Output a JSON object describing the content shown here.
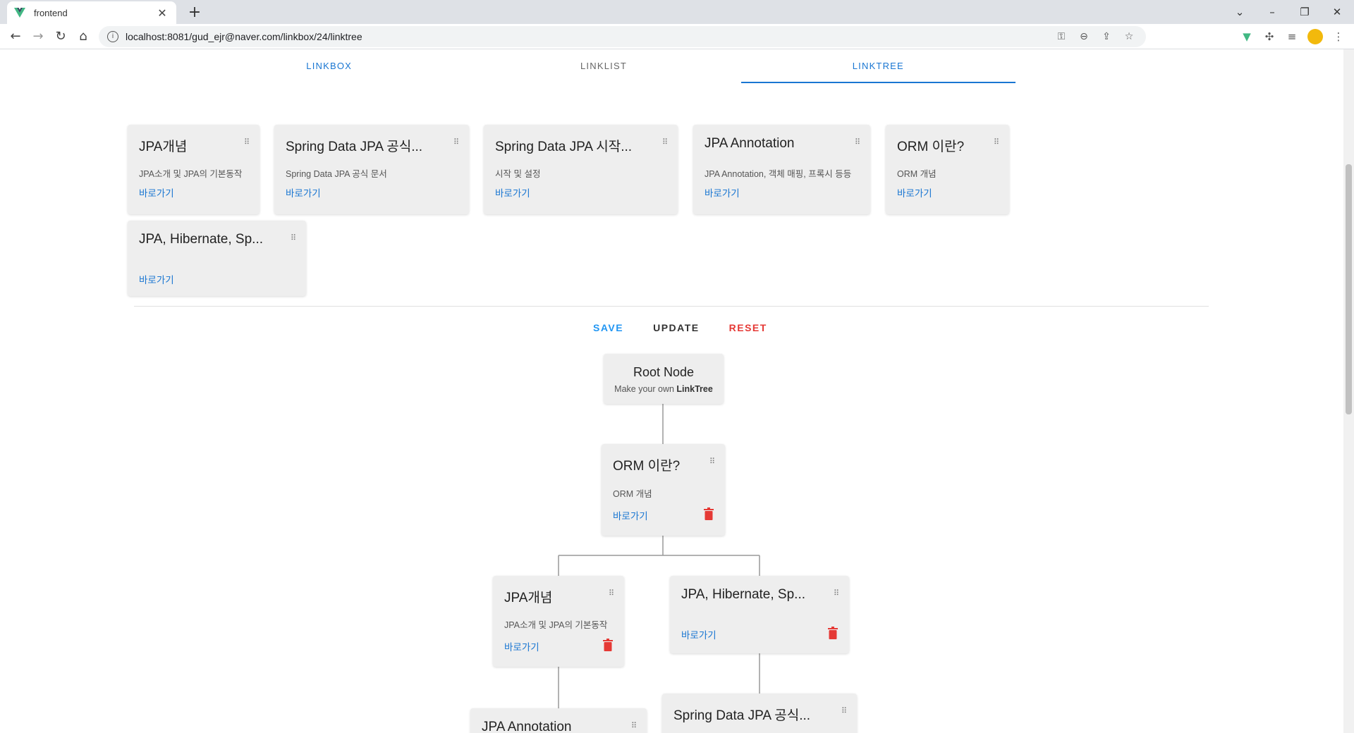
{
  "browser": {
    "tab_title": "frontend",
    "url": "localhost:8081/gud_ejr@naver.com/linkbox/24/linktree",
    "win_minimize": "–",
    "win_restore": "❐",
    "win_close": "✕",
    "win_tabsearch": "⌄"
  },
  "nav_tabs": [
    {
      "label": "LINKBOX"
    },
    {
      "label": "LINKLIST"
    },
    {
      "label": "LINKTREE"
    }
  ],
  "grid_cards": [
    {
      "title": "JPA개념",
      "desc": "JPA소개 및 JPA의 기본동작",
      "link": "바로가기"
    },
    {
      "title": "Spring Data JPA 공식...",
      "desc": "Spring Data JPA 공식 문서",
      "link": "바로가기"
    },
    {
      "title": "Spring Data JPA 시작...",
      "desc": "시작 및 설정",
      "link": "바로가기"
    },
    {
      "title": "JPA Annotation",
      "desc": "JPA Annotation, 객체 매핑, 프록시 등등",
      "link": "바로가기"
    },
    {
      "title": "ORM 이란?",
      "desc": "ORM 개념",
      "link": "바로가기"
    },
    {
      "title": "JPA, Hibernate, Sp...",
      "desc": "",
      "link": "바로가기"
    }
  ],
  "actions": {
    "save": "SAVE",
    "update": "UPDATE",
    "reset": "RESET"
  },
  "root_node": {
    "title": "Root Node",
    "sub_prefix": "Make your own ",
    "sub_bold": "LinkTree"
  },
  "tree_nodes": [
    {
      "title": "ORM 이란?",
      "desc": "ORM 개념",
      "link": "바로가기"
    },
    {
      "title": "JPA개념",
      "desc": "JPA소개 및 JPA의 기본동작",
      "link": "바로가기"
    },
    {
      "title": "JPA, Hibernate, Sp...",
      "desc": "",
      "link": "바로가기"
    },
    {
      "title": "JPA Annotation"
    },
    {
      "title": "Spring Data JPA 공식..."
    }
  ],
  "colors": {
    "accent": "#1976d2",
    "save": "#2196f3",
    "reset": "#e53935",
    "card_bg": "#eeeeee",
    "trash": "#e53935"
  }
}
